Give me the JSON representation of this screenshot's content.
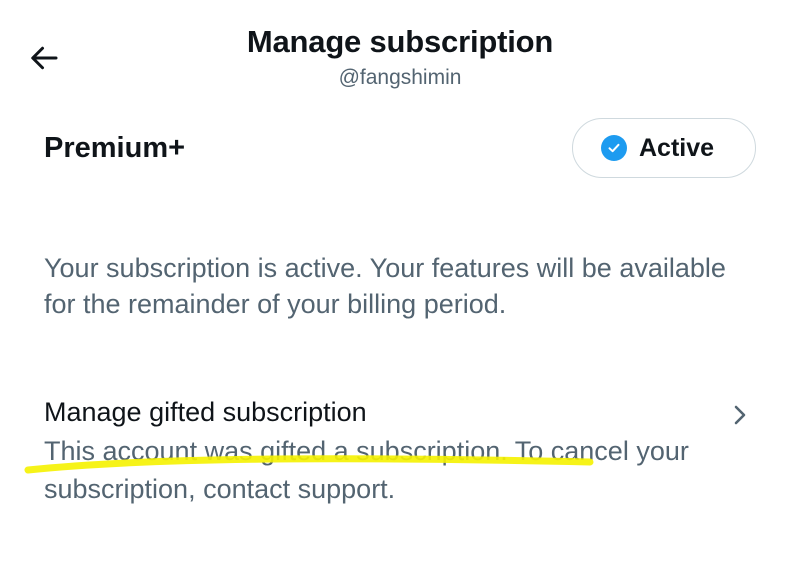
{
  "header": {
    "title": "Manage subscription",
    "handle": "@fangshimin",
    "back_icon": "arrow-left-icon"
  },
  "plan": {
    "name": "Premium+",
    "status": "Active",
    "status_icon": "check-circle-icon",
    "status_icon_color": "#1d9bf0"
  },
  "description": "Your subscription is active. Your features will be available for the remainder of your billing period.",
  "gifted": {
    "title": "Manage gifted subscription",
    "description": "This account was gifted a subscription. To cancel your subscription, contact support.",
    "chevron_icon": "chevron-right-icon"
  },
  "annotation": {
    "highlight_color": "#f5f200"
  }
}
